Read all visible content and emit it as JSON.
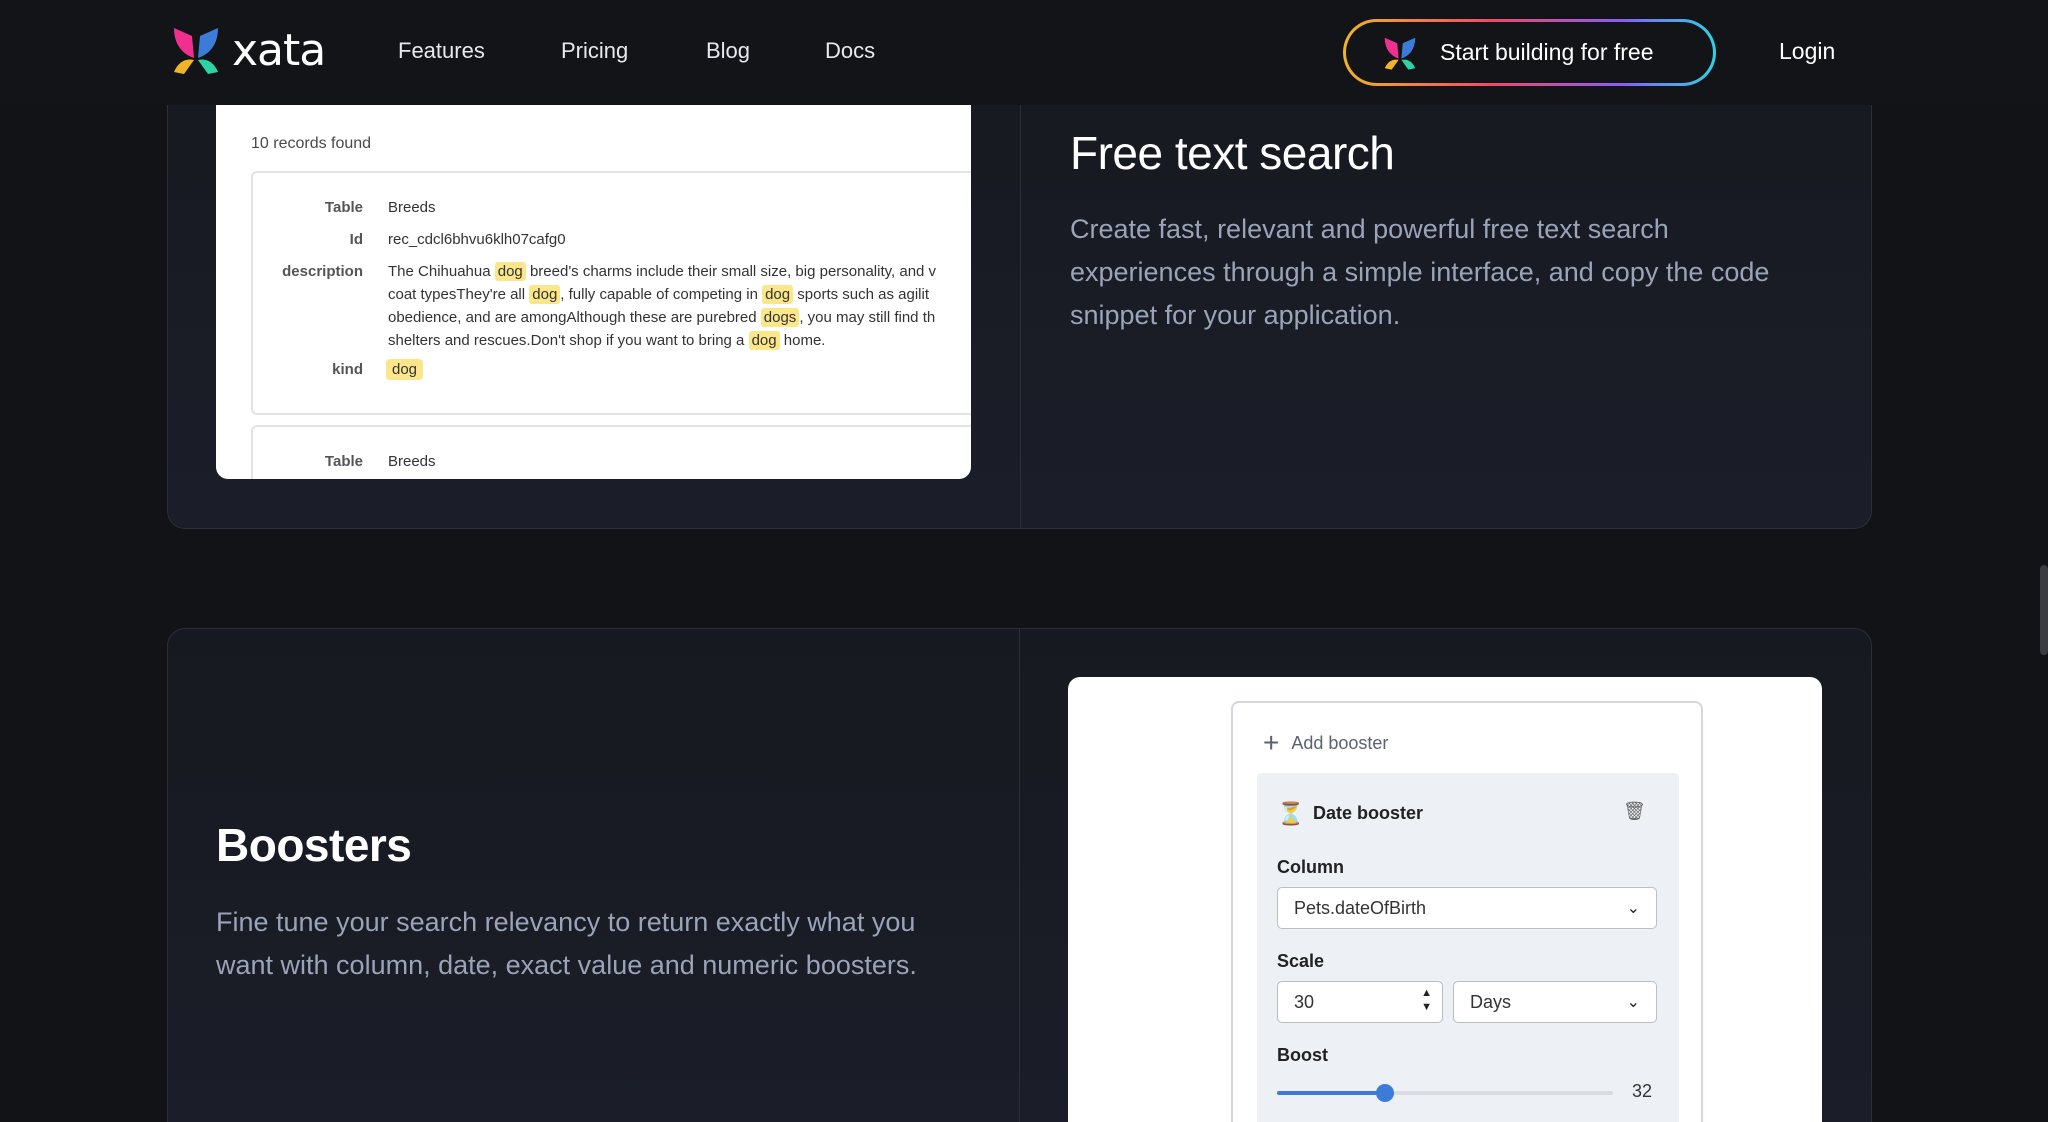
{
  "brand": {
    "name": "xata"
  },
  "nav": {
    "links": [
      "Features",
      "Pricing",
      "Blog",
      "Docs"
    ],
    "cta_label": "Start building for free",
    "login_label": "Login"
  },
  "free_text_search": {
    "title": "Free text search",
    "description": "Create fast, relevant and powerful free text search experiences through a simple interface, and copy the code snippet for your application.",
    "screenshot": {
      "records_found": "10 records found",
      "labels": {
        "table": "Table",
        "id": "Id",
        "description": "description",
        "kind": "kind"
      },
      "record1": {
        "table": "Breeds",
        "id": "rec_cdcl6bhvu6klh07cafg0",
        "kind": "dog",
        "description_segments": [
          [
            "The Chihuahua ",
            "dog",
            " breed's charms include their small size, big personality, and v"
          ],
          [
            "coat typesThey're all ",
            "dog",
            ", fully capable of competing in ",
            "dog",
            " sports such as agilit"
          ],
          [
            "obedience, and are amongAlthough these are purebred ",
            "dogs",
            ", you may still find th"
          ],
          [
            "shelters and rescues.Don't shop if you want to bring a ",
            "dog",
            " home."
          ]
        ]
      },
      "record2": {
        "table": "Breeds"
      }
    }
  },
  "boosters": {
    "title": "Boosters",
    "description": "Fine tune your search relevancy to return exactly what you want with column, date, exact value and numeric boosters.",
    "panel": {
      "add_booster": "Add booster",
      "booster_title": "Date booster",
      "column_label": "Column",
      "column_value": "Pets.dateOfBirth",
      "scale_label": "Scale",
      "scale_value": "30",
      "scale_unit": "Days",
      "boost_label": "Boost",
      "boost_value": "32",
      "boost_fraction": 0.32
    }
  },
  "colors": {
    "background": "#121317",
    "accent_blue": "#3d7bd9",
    "highlight": "#fbe68a",
    "muted_text": "#9aa3b8"
  },
  "icons": [
    "xata-logo-icon",
    "plus-icon",
    "hourglass-icon",
    "trash-icon",
    "chevron-down-icon"
  ]
}
